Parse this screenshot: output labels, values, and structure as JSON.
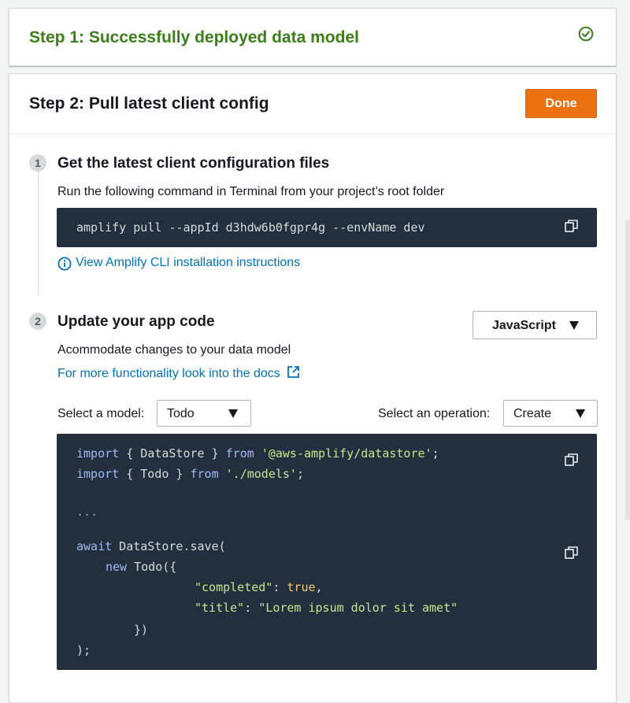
{
  "step1": {
    "title": "Step 1: Successfully deployed data model",
    "status_icon": "check-circle-icon"
  },
  "step2": {
    "title": "Step 2: Pull latest client config",
    "done_label": "Done",
    "substeps": [
      {
        "number": "1",
        "title": "Get the latest client configuration files",
        "description": "Run the following command in Terminal from your project’s root folder",
        "command": "amplify pull --appId d3hdw6b0fgpr4g --envName dev",
        "link_label": "View Amplify CLI installation instructions"
      },
      {
        "number": "2",
        "title": "Update your app code",
        "language": "JavaScript",
        "description": "Acommodate changes to your data model",
        "docs_link": "For more functionality look into the docs",
        "model_label": "Select a model:",
        "model_value": "Todo",
        "operation_label": "Select an operation:",
        "operation_value": "Create"
      }
    ]
  },
  "code": {
    "import_kw": "import",
    "from_kw": "from",
    "line1_mid": " { DataStore } ",
    "line1_module": "'@aws-amplify/datastore'",
    "line2_mid": " { Todo } ",
    "line2_module": "'./models'",
    "semicolon": ";",
    "ellipsis": "...",
    "await_kw": "await",
    "save_call": " DataStore.save(",
    "new_kw": "new",
    "todo_ctor": " Todo({",
    "key_completed": "\"completed\"",
    "colon": ": ",
    "val_true": "true",
    "comma": ",",
    "key_title": "\"title\"",
    "val_title": "\"Lorem ipsum dolor sit amet\"",
    "close_obj": "})",
    "close_call": ");"
  },
  "colors": {
    "success": "#3b7f19",
    "primary_button": "#ec7211",
    "link": "#0073bb",
    "code_bg": "#232f3e"
  }
}
